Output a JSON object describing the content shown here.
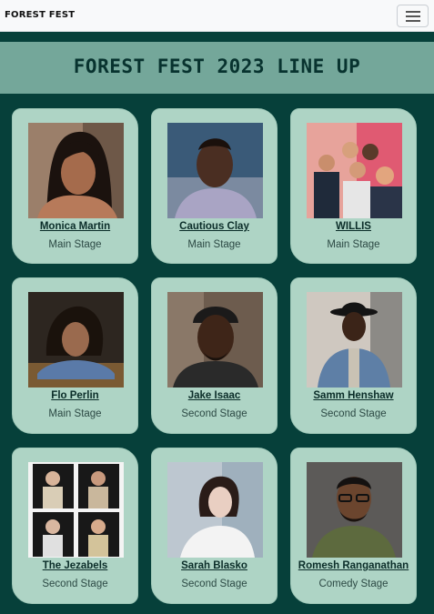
{
  "navbar": {
    "brand": "FOREST FEST",
    "menu_icon": "hamburger-menu-icon"
  },
  "banner": {
    "title": "FOREST FEST 2023 LINE UP"
  },
  "colors": {
    "page_background": "#06403a",
    "banner_background": "#74a79a",
    "card_background": "#aed4c5",
    "title_text": "#08332f"
  },
  "lineup": [
    {
      "name": "Monica Martin",
      "stage": "Main Stage"
    },
    {
      "name": "Cautious Clay",
      "stage": "Main Stage"
    },
    {
      "name": "WILLIS",
      "stage": "Main Stage"
    },
    {
      "name": "Flo Perlin",
      "stage": "Main Stage"
    },
    {
      "name": "Jake Isaac",
      "stage": "Second Stage"
    },
    {
      "name": "Samm Henshaw",
      "stage": "Second Stage"
    },
    {
      "name": "The Jezabels",
      "stage": "Second Stage"
    },
    {
      "name": "Sarah Blasko",
      "stage": "Second Stage"
    },
    {
      "name": "Romesh Ranganathan",
      "stage": "Comedy Stage"
    }
  ]
}
